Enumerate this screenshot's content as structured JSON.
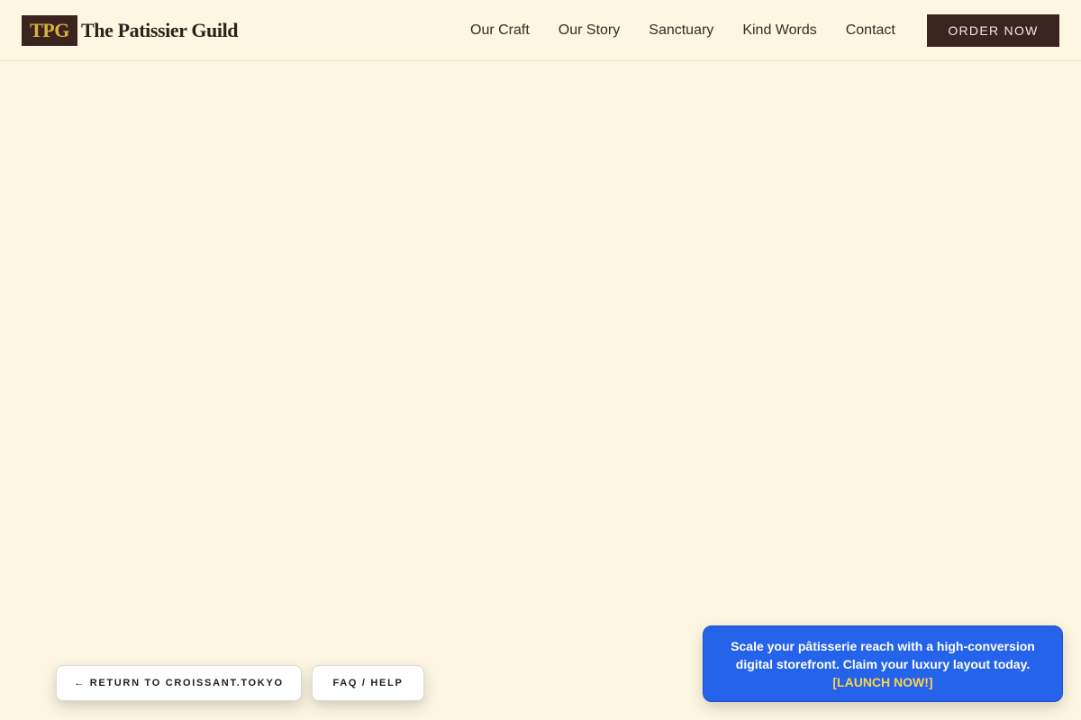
{
  "header": {
    "logo_mark": "TPG",
    "logo_text": "The Patissier Guild",
    "nav": [
      {
        "label": "Our Craft"
      },
      {
        "label": "Our Story"
      },
      {
        "label": "Sanctuary"
      },
      {
        "label": "Kind Words"
      },
      {
        "label": "Contact"
      }
    ],
    "order_label": "ORDER NOW"
  },
  "footer": {
    "return_label": "← RETURN TO CROISSANT.TOKYO",
    "faq_label": "FAQ / HELP"
  },
  "promo": {
    "line1": "Scale your pâtisserie reach with a high-conversion",
    "line2": "digital storefront. Claim your luxury layout today.",
    "cta": "[LAUNCH NOW!]"
  },
  "colors": {
    "background": "#fdf7e2",
    "brand_dark": "#3b2420",
    "logo_gold": "#d9b23e",
    "promo_blue": "#2563eb",
    "promo_cta": "#fcd34d"
  }
}
